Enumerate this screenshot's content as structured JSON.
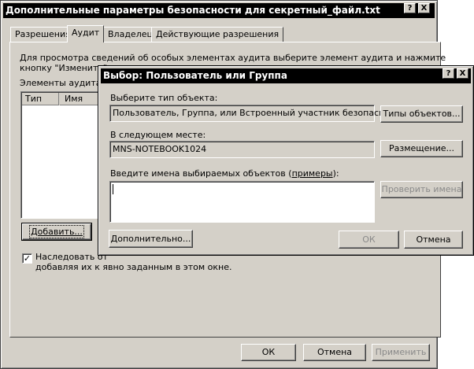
{
  "main": {
    "title": "Дополнительные параметры безопасности для секретный_файл.txt",
    "tabs": [
      {
        "label": "Разрешения"
      },
      {
        "label": "Аудит"
      },
      {
        "label": "Владелец"
      },
      {
        "label": "Действующие разрешения"
      }
    ],
    "description_line1": "Для просмотра сведений об особых элементах аудита выберите элемент аудита и нажмите",
    "description_line2": "кнопку \"Изменить\".",
    "audit_entries_label": "Элементы аудита:",
    "columns": [
      "Тип",
      "Имя"
    ],
    "add_button": "Добавить...",
    "inherit_line1": "Наследовать от",
    "inherit_line2": "добавляя их к явно заданным в этом окне.",
    "ok_button": "ОК",
    "cancel_button": "Отмена",
    "apply_button": "Применить"
  },
  "dialog": {
    "title": "Выбор: Пользователь или Группа",
    "object_type_label": "Выберите тип объекта:",
    "object_type_value": "Пользователь, Группа, или Встроенный участник безопасности",
    "object_types_button": "Типы объектов...",
    "location_label": "В следующем месте:",
    "location_value": "MNS-NOTEBOOK1024",
    "location_button": "Размещение...",
    "names_label_prefix": "Введите имена выбираемых объектов (",
    "names_label_link": "примеры",
    "names_label_suffix": "):",
    "names_value": "",
    "check_names_button": "Проверить имена",
    "advanced_button": "Дополнительно...",
    "ok_button": "ОК",
    "cancel_button": "Отмена"
  },
  "title_buttons": {
    "help": "?",
    "close": "X"
  },
  "checkbox_mark": "✓"
}
